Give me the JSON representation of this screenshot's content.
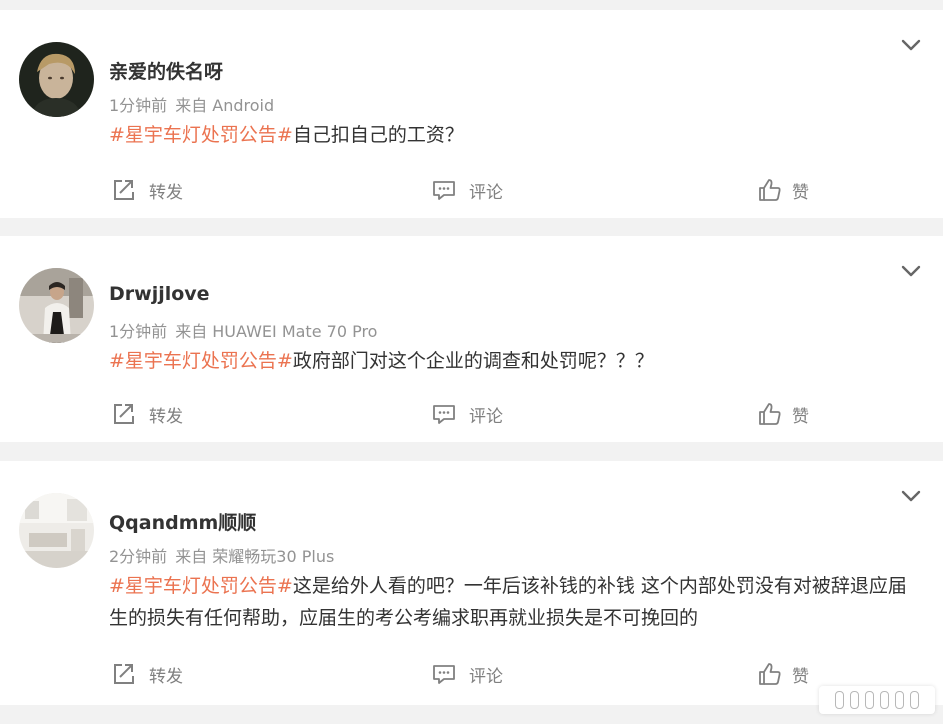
{
  "posts": [
    {
      "username": "亲爱的佚名呀",
      "time": "1分钟前",
      "source": "来自 Android",
      "hashtag": "#星宇车灯处罚公告#",
      "text": "自己扣自己的工资？",
      "avatar": "avatar-young-man-dark-background"
    },
    {
      "username": "Drwjjlove",
      "time": "1分钟前",
      "source": "来自 HUAWEI Mate 70 Pro",
      "hashtag": "#星宇车灯处罚公告#",
      "text": "政府部门对这个企业的调查和处罚呢？？？",
      "avatar": "avatar-person-in-white-coat"
    },
    {
      "username": "Qqandmm顺顺",
      "time": "2分钟前",
      "source": "来自 荣耀畅玩30 Plus",
      "hashtag": "#星宇车灯处罚公告#",
      "text": "这是给外人看的吧？一年后该补钱的补钱 这个内部处罚没有对被辞退应届生的损失有任何帮助，应届生的考公考编求职再就业损失是不可挽回的",
      "avatar": "avatar-bright-living-room"
    }
  ],
  "actions": {
    "repost": "转发",
    "comment": "评论",
    "like": "赞"
  },
  "colors": {
    "hashtag": "#eb7350",
    "meta": "#939393",
    "action": "#808080",
    "background": "#f2f2f2"
  },
  "icons": {
    "repost": "share-arrow-icon",
    "comment": "comment-bubble-icon",
    "like": "thumbs-up-icon",
    "menu": "chevron-down-icon"
  }
}
